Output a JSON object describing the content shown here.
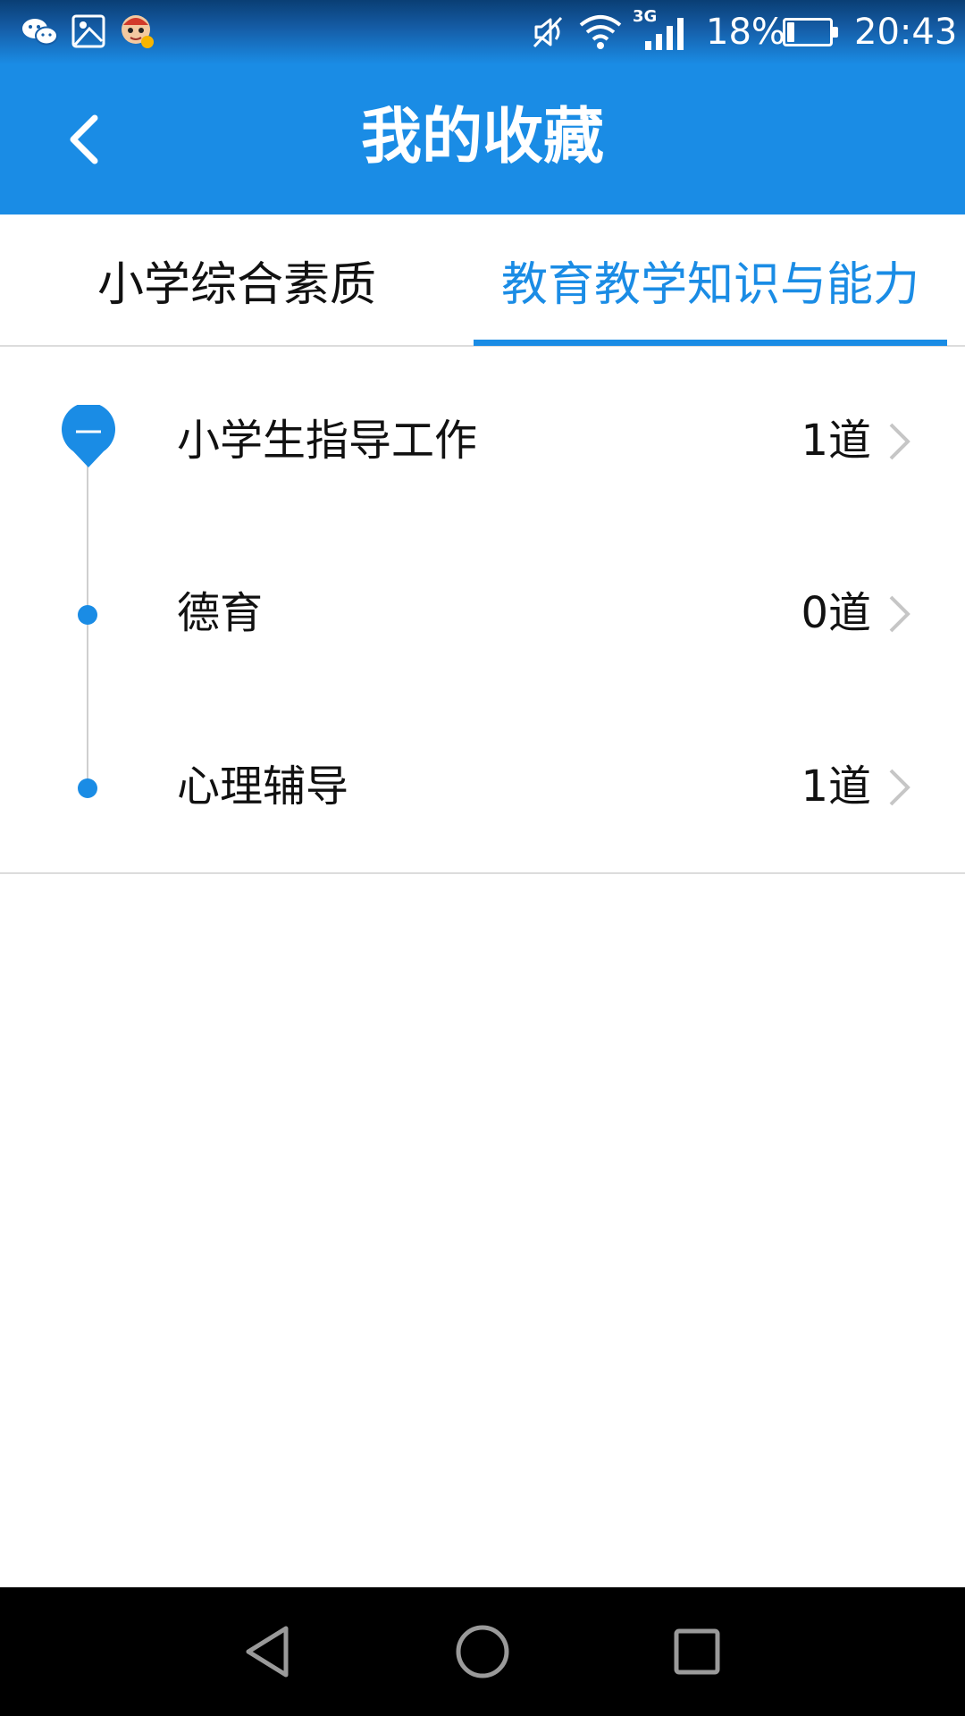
{
  "status_bar": {
    "icons": [
      "wechat-icon",
      "gallery-icon",
      "avatar-icon",
      "mute-icon",
      "wifi-icon",
      "signal-icon",
      "battery-icon"
    ],
    "network_type": "3G",
    "battery_percent": "18%",
    "battery_level": 0.18,
    "time": "20:43"
  },
  "app_bar": {
    "title": "我的收藏",
    "back_icon": "chevron-left-icon"
  },
  "tabs": [
    {
      "label": "小学综合素质",
      "active": false
    },
    {
      "label": "教育教学知识与能力",
      "active": true
    }
  ],
  "list": {
    "items": [
      {
        "label": "小学生指导工作",
        "count": "1道",
        "node": "collapse-pin"
      },
      {
        "label": "德育",
        "count": "0道",
        "node": "dot"
      },
      {
        "label": "心理辅导",
        "count": "1道",
        "node": "dot"
      }
    ],
    "chevron_icon": "chevron-right-icon"
  },
  "nav_bar": {
    "icons": [
      "triangle-back-icon",
      "circle-home-icon",
      "square-recent-icon"
    ]
  },
  "colors": {
    "accent": "#1a8ce5",
    "text": "#111111",
    "divider": "#dcdcdc",
    "chevron": "#c6c6c6",
    "nav_bar": "#000000"
  }
}
